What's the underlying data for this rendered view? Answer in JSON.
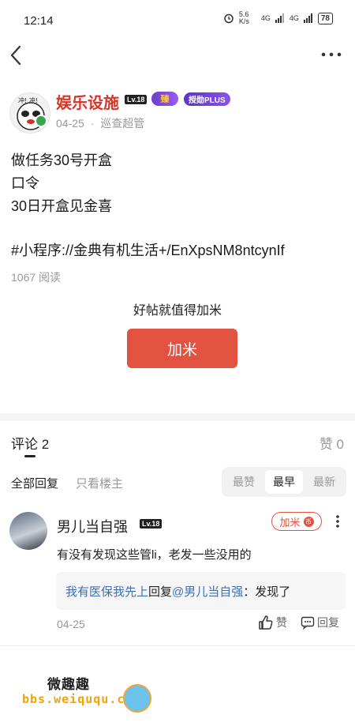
{
  "status_bar": {
    "time": "12:14",
    "network_speed": "5.6 K/s",
    "signal1": "4G",
    "signal2": "4G",
    "battery": "78"
  },
  "nav": {
    "back_icon": "chevron-left-icon",
    "more_icon": "more-dots-icon"
  },
  "author": {
    "name": "娱乐设施",
    "level": "Lv.18",
    "medal_text": "臻",
    "plus_badge": "授勋PLUS",
    "date": "04-25",
    "role": "巡查超管",
    "date_role_separator": "·"
  },
  "post": {
    "lines": [
      "做任务30号开盒",
      "口令",
      "30日开盒见金喜",
      "#小程序://金典有机生活+/EnXpsNM8ntcynIf"
    ],
    "reads": "1067 阅读",
    "reward_prompt": "好帖就值得加米",
    "reward_button": "加米"
  },
  "comments_header": {
    "title": "评论 2",
    "likes": "赞 0",
    "filters": [
      "全部回复",
      "只看楼主"
    ],
    "sort": [
      "最赞",
      "最早",
      "最新"
    ],
    "active_sort": "最早"
  },
  "comment": {
    "author": "男儿当自强",
    "level": "Lv.18",
    "reward_label": "加米",
    "coin_glyph": "币",
    "text": "有没有发现这些管li，老发一些没用的",
    "reply": {
      "from": "我有医保我先上",
      "verb": "回复",
      "to": "@男儿当自强",
      "text": "：发现了"
    },
    "date": "04-25",
    "like_label": "赞",
    "reply_label": "回复"
  },
  "watermark": {
    "line1": "微趣趣",
    "line2": "bbs.weiququ.cn"
  },
  "colors": {
    "accent": "#e15241",
    "author_name": "#d6362a",
    "link_blue": "#3d6fb6"
  }
}
